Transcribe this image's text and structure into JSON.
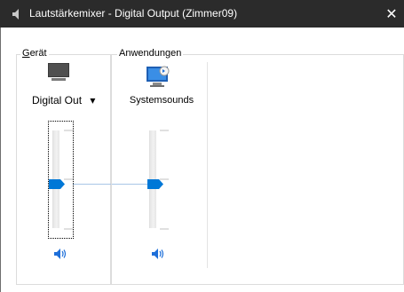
{
  "window": {
    "title": "Lautstärkemixer - Digital Output (Zimmer09)",
    "close_glyph": "✕",
    "title_icon": "speaker-icon"
  },
  "device_group": {
    "label_underlined": "G",
    "label_rest": "erät",
    "device_name": "Digital Out",
    "dropdown_glyph": "▾",
    "device_icon": "monitor-icon",
    "volume_level_fraction": 0.52,
    "mute_icon": "speaker-unmuted-icon"
  },
  "applications_group": {
    "label": "Anwendungen",
    "apps": [
      {
        "name": "Systemsounds",
        "icon": "system-sounds-icon",
        "volume_level_fraction": 0.52,
        "mute_icon": "speaker-unmuted-icon"
      }
    ]
  },
  "colors": {
    "titlebar": "#2b2b2b",
    "accent": "#0078d7",
    "slider_track": "#ececec"
  }
}
